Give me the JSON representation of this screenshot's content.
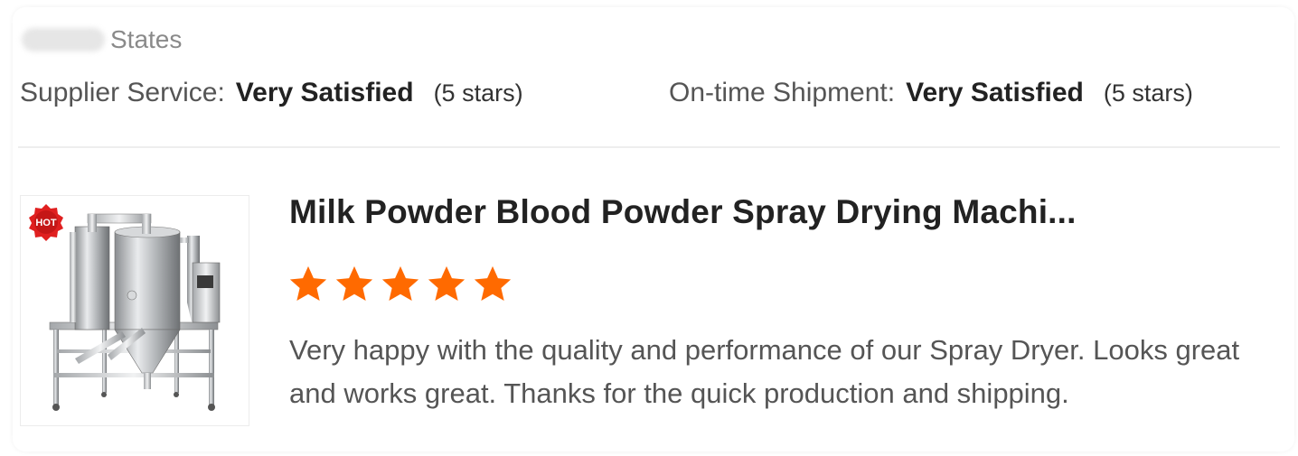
{
  "country": {
    "visible_text": "States"
  },
  "ratings": [
    {
      "label": "Supplier Service:",
      "value": "Very Satisfied",
      "stars_text": "(5 stars)"
    },
    {
      "label": "On-time Shipment:",
      "value": "Very Satisfied",
      "stars_text": "(5 stars)"
    }
  ],
  "product": {
    "badge": "HOT",
    "title": "Milk Powder Blood Powder Spray Drying Machi...",
    "image_icon": "spray-dryer-machine-image",
    "rating": 5,
    "rating_max": 5
  },
  "review": {
    "text": "Very happy with the quality and performance of our Spray Dryer.  Looks great and works great.  Thanks for the quick production and shipping."
  },
  "colors": {
    "star": "#ff6a00",
    "badge": "#e02020"
  }
}
